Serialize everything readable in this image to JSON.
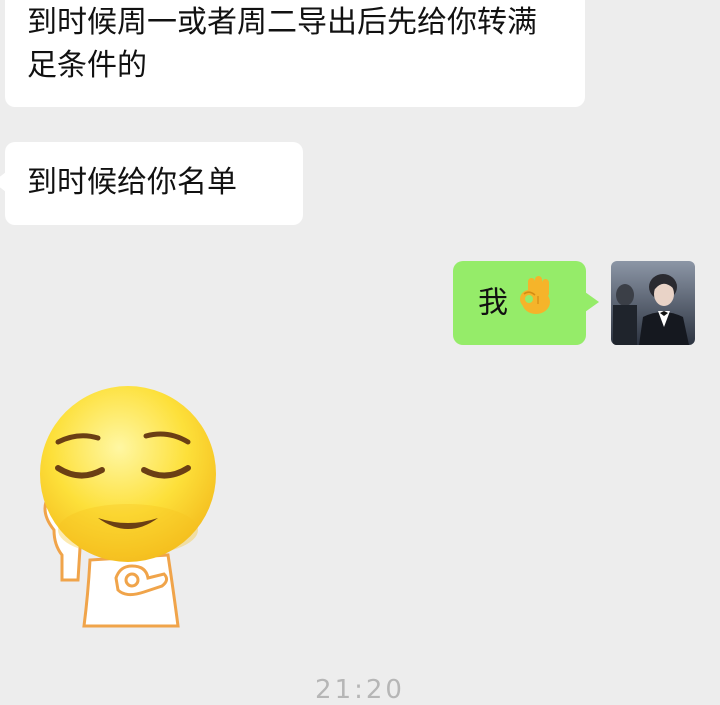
{
  "messages": [
    {
      "side": "left",
      "text": "到时候周一或者周二导出后先给你转满足条件的"
    },
    {
      "side": "left",
      "text": "到时候给你名单"
    },
    {
      "side": "right",
      "text": "我",
      "emoji": "ok-hand-emoji"
    },
    {
      "side": "left",
      "type": "sticker",
      "sticker": "smiling-face-ok-gesture-sticker"
    }
  ],
  "timestamp": "21:20",
  "colors": {
    "background": "#ededed",
    "incoming_bubble": "#ffffff",
    "outgoing_bubble": "#95ec69",
    "text": "#111111",
    "timestamp": "#b6b6b6"
  }
}
